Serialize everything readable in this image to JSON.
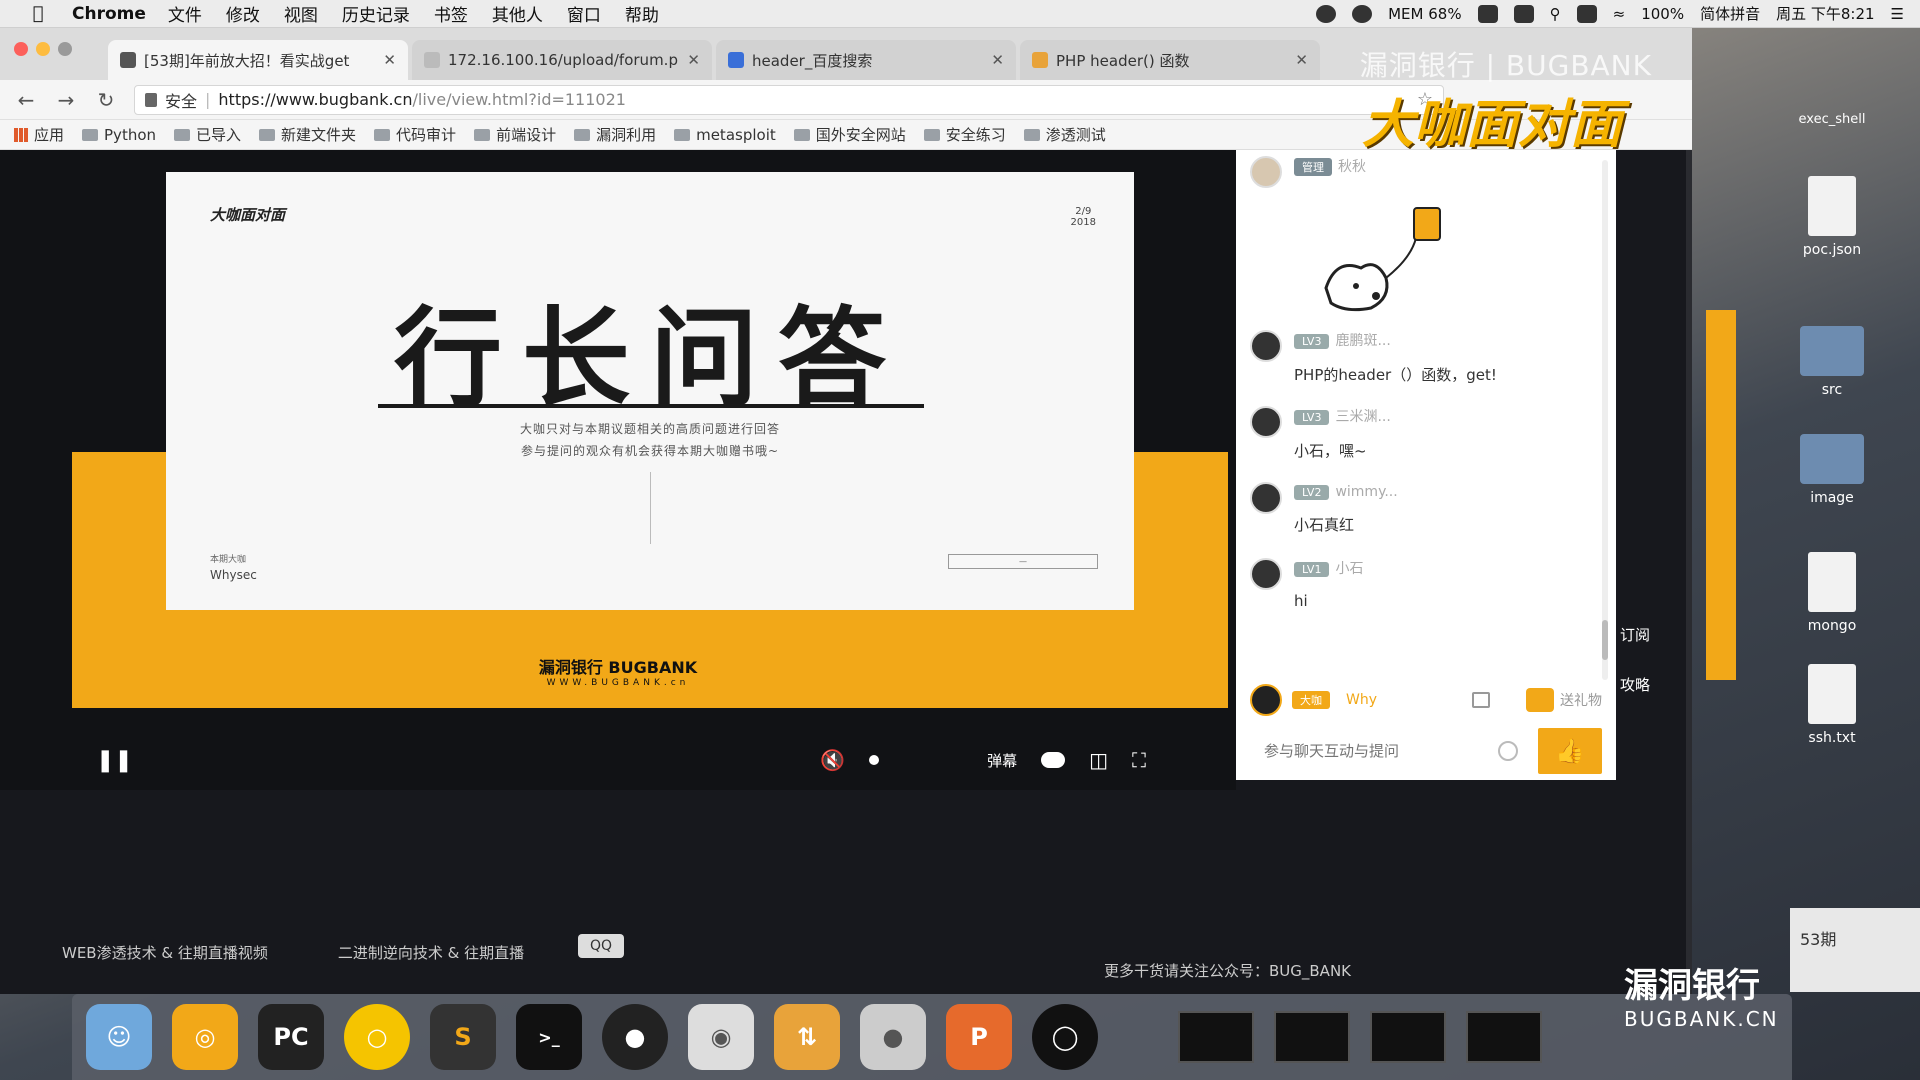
{
  "menubar": {
    "app_name": "Chrome",
    "menus": [
      "文件",
      "修改",
      "视图",
      "历史记录",
      "书签",
      "其他人",
      "窗口",
      "帮助"
    ],
    "mem_label": "MEM",
    "mem_value": "68%",
    "battery": "100%",
    "input_method": "简体拼音",
    "clock": "周五 下午8:21"
  },
  "tabs": [
    {
      "title": "[53期]年前放大招！看实战get",
      "active": true
    },
    {
      "title": "172.16.100.16/upload/forum.p",
      "active": false
    },
    {
      "title": "header_百度搜索",
      "active": false
    },
    {
      "title": "PHP header() 函数",
      "active": false
    }
  ],
  "overlay": {
    "watermark": "漏洞银行 | BUGBANK",
    "brand": "大咖面对面",
    "desk_label": "exec_shell"
  },
  "omnibox": {
    "secure_label": "安全",
    "url_host": "https://www.bugbank.cn",
    "url_path": "/live/view.html?id=111021"
  },
  "bookmarks": [
    "应用",
    "Python",
    "已导入",
    "新建文件夹",
    "代码审计",
    "前端设计",
    "漏洞利用",
    "metasploit",
    "国外安全网站",
    "安全练习",
    "渗透测试"
  ],
  "slide": {
    "logo": "大咖面对面",
    "date_top": "2/9",
    "date_year": "2018",
    "headline": "行长问答",
    "desc_line1": "大咖只对与本期议题相关的高质问题进行回答",
    "desc_line2": "参与提问的观众有机会获得本期大咖赠书哦~",
    "presenter_label": "本期大咖",
    "presenter": "Whysec",
    "footer_brand": "漏洞银行  BUGBANK",
    "footer_url": "WWW.BUGBANK.cn"
  },
  "player": {
    "danmaku_label": "弹幕"
  },
  "chat": {
    "messages": [
      {
        "badge": "管理",
        "user": "秋秋",
        "text": ""
      },
      {
        "badge": "LV3",
        "user": "鹿鹏斑...",
        "text": "PHP的header（）函数，get!"
      },
      {
        "badge": "LV3",
        "user": "三米渊...",
        "text": "小石，嘿~"
      },
      {
        "badge": "LV2",
        "user": "wimmy...",
        "text": "小石真红"
      },
      {
        "badge": "LV1",
        "user": "小石",
        "text": "hi"
      }
    ],
    "host_badge": "大咖",
    "host_user": "Why",
    "gift_label": "送礼物",
    "input_placeholder": "参与聊天互动与提问"
  },
  "side_links": [
    "订阅",
    "攻略"
  ],
  "bottom": {
    "link1": "WEB渗透技术 & 往期直播视频",
    "link2": "二进制逆向技术 & 往期直播",
    "qq_tip": "QQ",
    "wechat_note": "更多干货请关注公众号：BUG_BANK"
  },
  "desktop_files": [
    "poc.json",
    "src",
    "image",
    "mongo",
    "ssh.txt"
  ],
  "desk_brand": {
    "cn": "漏洞银行",
    "en": "BUGBANK.CN"
  },
  "notification": "53期",
  "dock": [
    "Finder",
    "NetEase Music",
    "PyCharm",
    "Chrome",
    "Sublime",
    "Terminal",
    "QQ",
    "WeChat",
    "Sequel",
    "TablePlus",
    "PowerPoint",
    "OBS"
  ]
}
